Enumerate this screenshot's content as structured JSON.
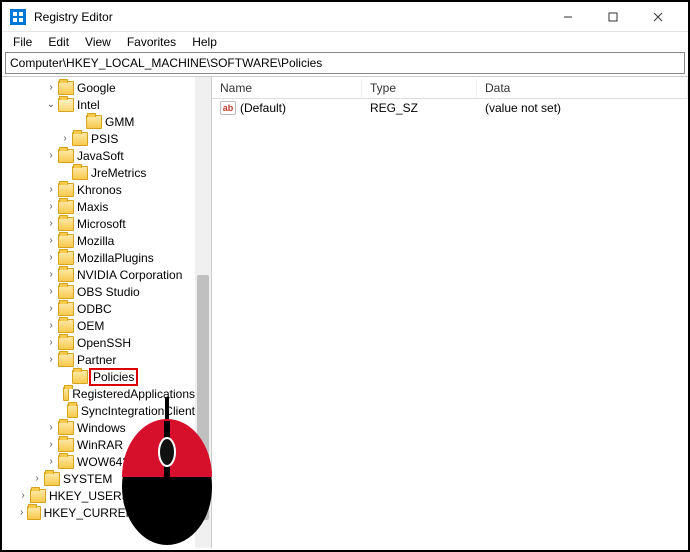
{
  "window": {
    "title": "Registry Editor"
  },
  "menu": {
    "file": "File",
    "edit": "Edit",
    "view": "View",
    "favorites": "Favorites",
    "help": "Help"
  },
  "address": "Computer\\HKEY_LOCAL_MACHINE\\SOFTWARE\\Policies",
  "tree": {
    "google": "Google",
    "intel": "Intel",
    "gmm": "GMM",
    "psis": "PSIS",
    "javasoft": "JavaSoft",
    "jremetrics": "JreMetrics",
    "khronos": "Khronos",
    "maxis": "Maxis",
    "microsoft": "Microsoft",
    "mozilla": "Mozilla",
    "mozillaplugins": "MozillaPlugins",
    "nvidia": "NVIDIA Corporation",
    "obs": "OBS Studio",
    "odbc": "ODBC",
    "oem": "OEM",
    "openssh": "OpenSSH",
    "partner": "Partner",
    "policies": "Policies",
    "regapp": "RegisteredApplications",
    "syncint": "SyncIntegrationClient",
    "windows": "Windows",
    "winrar": "WinRAR",
    "wow": "WOW6432Node",
    "system": "SYSTEM",
    "hku": "HKEY_USERS",
    "hkcc": "HKEY_CURRENT_CONFIG"
  },
  "list": {
    "headers": {
      "name": "Name",
      "type": "Type",
      "data": "Data"
    },
    "rows": [
      {
        "icon": "ab",
        "name": "(Default)",
        "type": "REG_SZ",
        "data": "(value not set)"
      }
    ]
  }
}
